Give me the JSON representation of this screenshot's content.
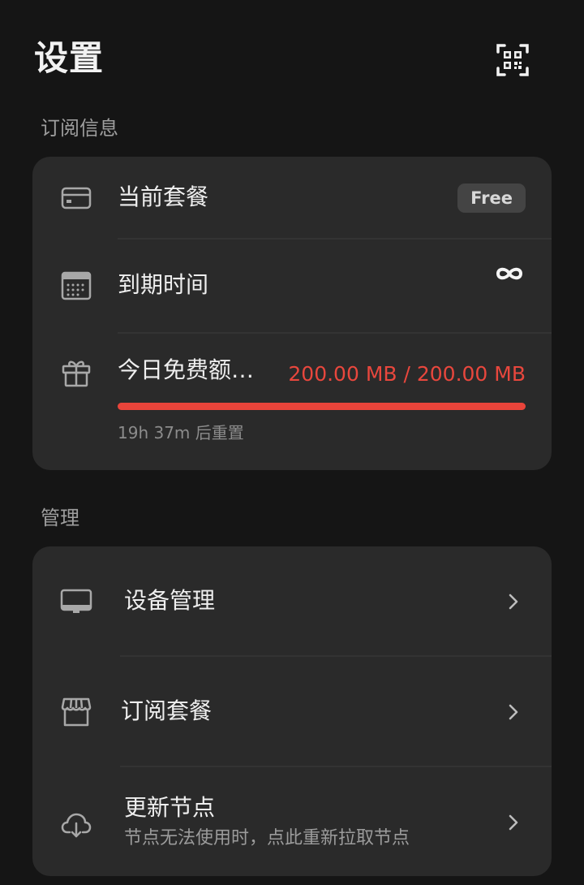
{
  "header": {
    "title": "设置",
    "scan_icon": "qr-scan-icon"
  },
  "subscription": {
    "section_label": "订阅信息",
    "plan": {
      "label": "当前套餐",
      "badge": "Free",
      "icon": "credit-card-icon"
    },
    "expiry": {
      "label": "到期时间",
      "value_icon": "infinity-icon",
      "icon": "calendar-icon"
    },
    "quota": {
      "label": "今日免费额…",
      "usage": "200.00 MB / 200.00 MB",
      "used_fraction": 1.0,
      "reset_note": "19h 37m 后重置",
      "icon": "gift-icon",
      "accent_color": "#e9443a"
    }
  },
  "management": {
    "section_label": "管理",
    "items": [
      {
        "label": "设备管理",
        "icon": "monitor-icon"
      },
      {
        "label": "订阅套餐",
        "icon": "store-icon"
      },
      {
        "label": "更新节点",
        "sublabel": "节点无法使用时，点此重新拉取节点",
        "icon": "cloud-download-icon"
      }
    ]
  }
}
